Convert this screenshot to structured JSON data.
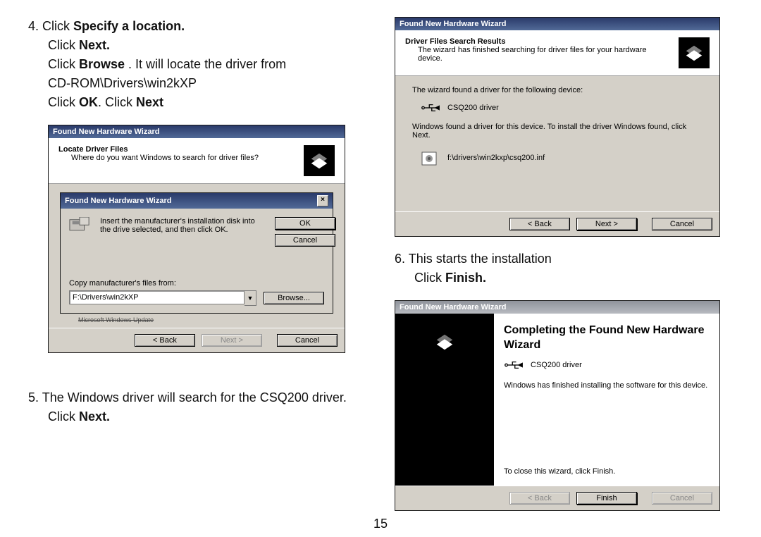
{
  "page_number": "15",
  "steps": {
    "s4": {
      "num": "4.",
      "l1a": "Click ",
      "l1b": "Specify a location.",
      "l2a": "Click ",
      "l2b": "Next.",
      "l3a": "Click ",
      "l3b": "Browse ",
      "l3c": ". It will locate the driver from",
      "l4": "CD-ROM\\Drivers\\win2kXP",
      "l5a": "Click ",
      "l5b": "OK",
      "l5c": ".    Click ",
      "l5d": "Next"
    },
    "s5": {
      "num": "5.",
      "l1": "The Windows driver will search for the CSQ200 driver.",
      "l2a": "Click ",
      "l2b": "Next."
    },
    "s6": {
      "num": "6.",
      "l1": "This starts the installation",
      "l2a": "Click ",
      "l2b": "Finish."
    }
  },
  "screens": {
    "s4": {
      "outer_title": "Found New Hardware Wizard",
      "header_h1": "Locate Driver Files",
      "header_h2": "Where do you want Windows to search for driver files?",
      "inner_title": "Found New Hardware Wizard",
      "inner_text": "Insert the manufacturer's installation disk into the drive selected, and then click OK.",
      "copy_label": "Copy manufacturer's files from:",
      "path_value": "F:\\Drivers\\win2kXP",
      "ok": "OK",
      "cancel": "Cancel",
      "browse": "Browse...",
      "back": "< Back",
      "next": "Next >",
      "cancel2": "Cancel",
      "cutoff_label": "Microsoft Windows Update"
    },
    "s5": {
      "title": "Found New Hardware Wizard",
      "h1": "Driver Files Search Results",
      "h2": "The wizard has finished searching for driver files for your hardware device.",
      "found_line": "The wizard found a driver for the following device:",
      "device": "CSQ200 driver",
      "install_line": "Windows found a driver for this device. To install the driver Windows found, click Next.",
      "inf_path": "f:\\drivers\\win2kxp\\csq200.inf",
      "back": "< Back",
      "next": "Next >",
      "cancel": "Cancel"
    },
    "s6": {
      "title": "Found New Hardware Wizard",
      "heading": "Completing the Found New Hardware Wizard",
      "device": "CSQ200 driver",
      "msg": "Windows has finished installing the software for this device.",
      "close_msg": "To close this wizard, click Finish.",
      "back": "< Back",
      "finish": "Finish",
      "cancel": "Cancel"
    }
  }
}
